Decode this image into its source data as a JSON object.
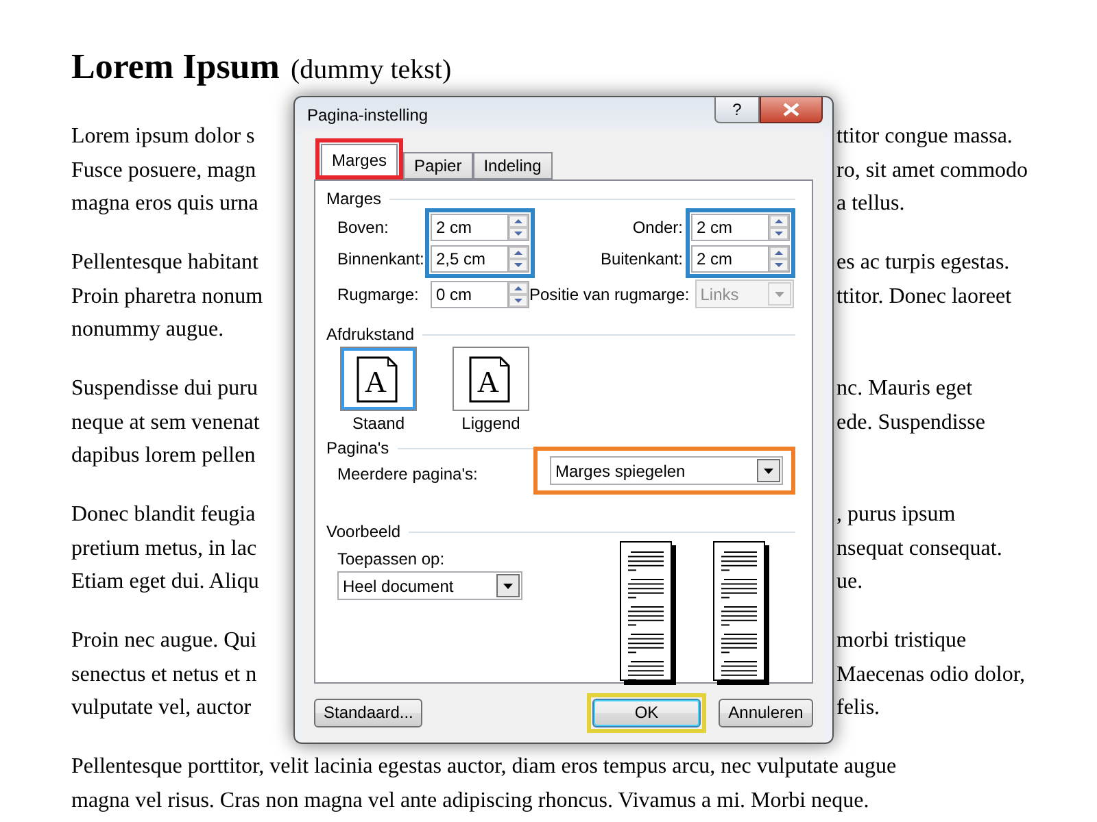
{
  "document": {
    "heading": "Lorem Ipsum",
    "subtitle": "(dummy tekst)",
    "paragraphs": [
      {
        "lines": [
          [
            "Lorem ipsum dolor s",
            "ttitor congue massa."
          ],
          [
            "Fusce posuere, magn",
            "ro, sit amet commodo"
          ],
          [
            "magna eros quis urna",
            "a tellus."
          ]
        ]
      },
      {
        "lines": [
          [
            "Pellentesque habitant",
            "es ac turpis egestas."
          ],
          [
            "Proin pharetra nonum",
            "ttitor. Donec laoreet"
          ],
          [
            "nonummy augue."
          ]
        ]
      },
      {
        "lines": [
          [
            "Suspendisse dui puru",
            "nc. Mauris eget"
          ],
          [
            "neque at sem venenat",
            "ede. Suspendisse"
          ],
          [
            "dapibus lorem pellen"
          ]
        ]
      },
      {
        "lines": [
          [
            "Donec blandit feugia",
            ", purus ipsum"
          ],
          [
            "pretium metus, in lac",
            "nsequat consequat."
          ],
          [
            "Etiam eget dui. Aliqu",
            "ue."
          ]
        ]
      },
      {
        "lines": [
          [
            "Proin nec augue. Qui",
            "morbi tristique"
          ],
          [
            "senectus et netus et n",
            "Maecenas odio dolor,"
          ],
          [
            "vulputate vel, auctor",
            "felis."
          ]
        ]
      },
      {
        "lines": [
          [
            "Pellentesque porttitor, velit lacinia egestas auctor, diam eros tempus arcu, nec vulputate augue"
          ],
          [
            "magna vel risus. Cras non magna vel ante adipiscing rhoncus. Vivamus a mi. Morbi neque."
          ]
        ]
      }
    ]
  },
  "dialog": {
    "title": "Pagina-instelling",
    "help_button": "?",
    "tabs": [
      {
        "label": "Marges",
        "selected": true,
        "highlight": {
          "color": "#e8262d"
        }
      },
      {
        "label": "Papier",
        "selected": false
      },
      {
        "label": "Indeling",
        "selected": false
      }
    ],
    "margins": {
      "title": "Marges",
      "groups": [
        {
          "highlight": {
            "color": "#2e86c6"
          },
          "fields": [
            {
              "label": "Boven:",
              "value": "2 cm"
            },
            {
              "label": "Binnenkant:",
              "value": "2,5 cm"
            }
          ]
        },
        {
          "highlight": {
            "color": "#2e86c6"
          },
          "fields": [
            {
              "label": "Onder:",
              "value": "2 cm"
            },
            {
              "label": "Buitenkant:",
              "value": "2 cm"
            }
          ]
        }
      ],
      "gutter": {
        "label": "Rugmarge:",
        "value": "0 cm"
      },
      "gutter_position": {
        "label": "Positie van rugmarge:",
        "value": "Links",
        "disabled": true
      }
    },
    "orientation": {
      "title": "Afdrukstand",
      "options": [
        {
          "label": "Staand",
          "glyph": "A",
          "selected": true
        },
        {
          "label": "Liggend",
          "glyph": "A",
          "selected": false
        }
      ]
    },
    "pages": {
      "title": "Pagina's",
      "label": "Meerdere pagina's:",
      "value": "Marges spiegelen",
      "highlight": {
        "color": "#f07f2a"
      }
    },
    "preview": {
      "title": "Voorbeeld",
      "label": "Toepassen op:",
      "value": "Heel document"
    },
    "buttons": [
      {
        "label": "Standaard...",
        "kind": "plain"
      },
      {
        "label": "OK",
        "kind": "default",
        "highlight": {
          "color": "#e3d23a"
        }
      },
      {
        "label": "Annuleren",
        "kind": "plain"
      }
    ]
  }
}
